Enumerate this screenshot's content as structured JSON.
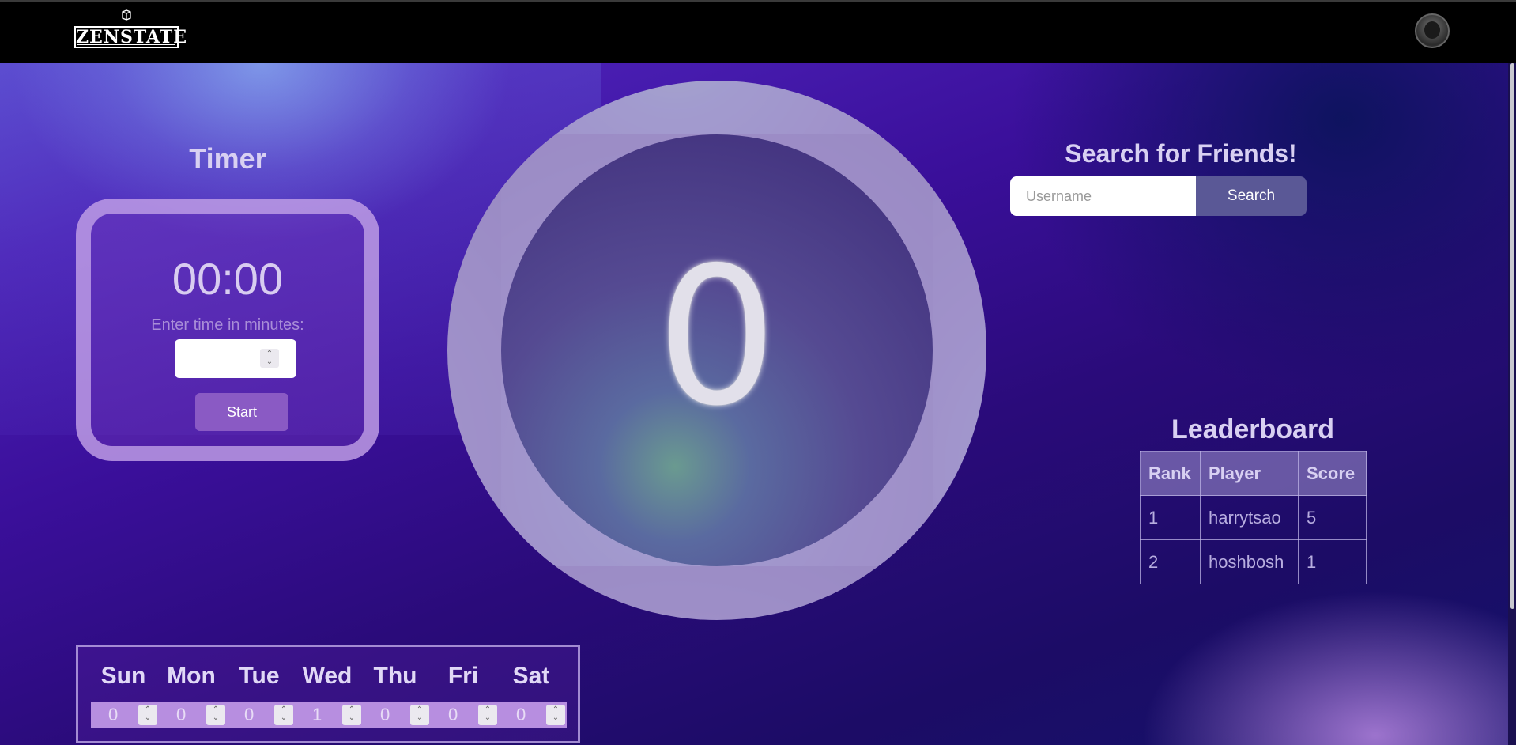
{
  "header": {
    "logo_text": "ZENSTATE",
    "avatar_label": "user-avatar"
  },
  "timer": {
    "title": "Timer",
    "display": "00:00",
    "label": "Enter time in minutes:",
    "input_value": "",
    "start_label": "Start"
  },
  "counter": {
    "value": "0"
  },
  "search": {
    "title": "Search for Friends!",
    "placeholder": "Username",
    "button_label": "Search"
  },
  "leaderboard": {
    "title": "Leaderboard",
    "columns": [
      "Rank",
      "Player",
      "Score"
    ],
    "rows": [
      [
        "1",
        "harrytsao",
        "5"
      ],
      [
        "2",
        "hoshbosh",
        "1"
      ]
    ]
  },
  "week": {
    "days": [
      "Sun",
      "Mon",
      "Tue",
      "Wed",
      "Thu",
      "Fri",
      "Sat"
    ],
    "values": [
      "0",
      "0",
      "0",
      "1",
      "0",
      "0",
      "0"
    ]
  },
  "colors": {
    "navbar": "#000000",
    "accent_button": "#8a5ac4",
    "search_button": "#5a5896"
  }
}
